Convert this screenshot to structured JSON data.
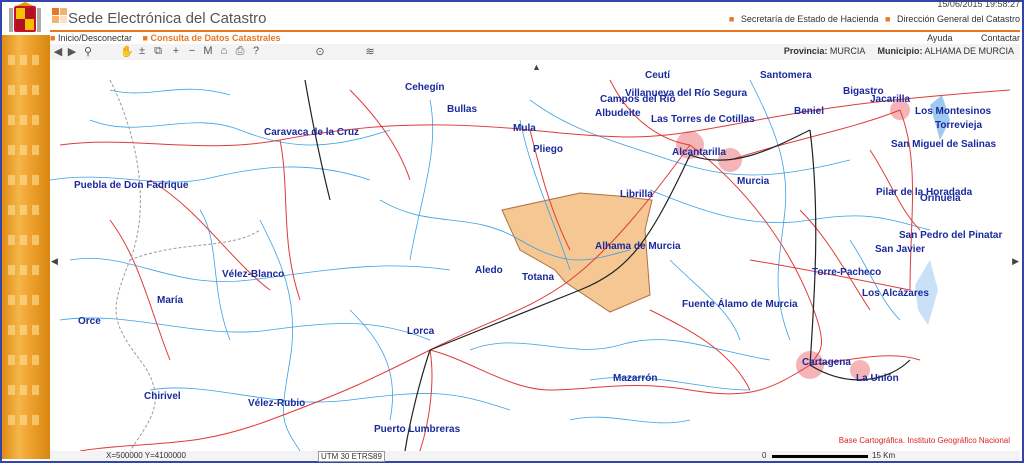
{
  "header": {
    "title": "Sede Electrónica del Catastro",
    "datetime": "15/06/2015 19:58:27",
    "links": [
      "Secretaría de Estado de Hacienda",
      "Dirección General del Catastro"
    ]
  },
  "nav": {
    "items": [
      "Inicio/Desconectar",
      "Consulta de Datos Catastrales"
    ],
    "right": [
      "Ayuda",
      "Contactar"
    ]
  },
  "toolbar": {
    "provincia_label": "Provincia:",
    "provincia_value": "MURCIA",
    "municipio_label": "Municipio:",
    "municipio_value": "ALHAMA DE MURCIA"
  },
  "map": {
    "towns": [
      "Cehegín",
      "Bullas",
      "Caravaca de la Cruz",
      "Mula",
      "Pliego",
      "Albudeite",
      "Campos del Río",
      "Villanueva del Río Segura",
      "Las Torres de Cotillas",
      "Ceutí",
      "Santomera",
      "Beniel",
      "Bigastro",
      "Jacarilla",
      "Los Montesinos",
      "Torrevieja",
      "San Miguel de Salinas",
      "Alcantarilla",
      "Murcia",
      "Librilla",
      "Alhama de Murcia",
      "Puebla de Don Fadrique",
      "Pilar de la Horadada",
      "Orihuela",
      "San Pedro del Pinatar",
      "San Javier",
      "Vélez-Blanco",
      "Aledo",
      "Totana",
      "Torre-Pacheco",
      "María",
      "Fuente Álamo de Murcia",
      "Los Alcázares",
      "Orce",
      "Lorca",
      "Cartagena",
      "La Unión",
      "Mazarrón",
      "Chirivel",
      "Vélez-Rubio",
      "Puerto Lumbreras"
    ],
    "attribution": "Base Cartográfica. Instituto Geográfico Nacional"
  },
  "status": {
    "coords": "X=500000 Y=4100000",
    "srs": "UTM 30 ETRS89",
    "scale_start": "0",
    "scale_end": "15 Km"
  }
}
